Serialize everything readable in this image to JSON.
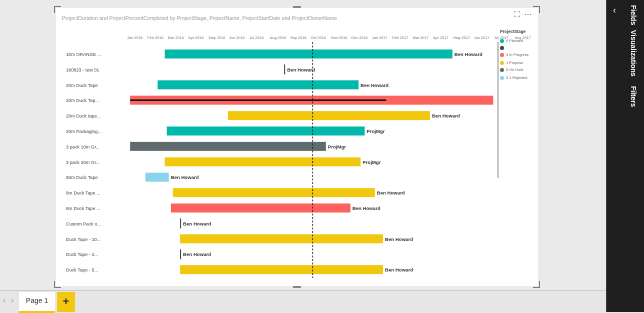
{
  "visual": {
    "title": "ProjectDuration and ProjectPercentCompleted by ProjectStage, ProjectName, ProjectStartDate and ProjectOwnerName",
    "icons": [
      "focus-mode-icon",
      "more-options-icon"
    ]
  },
  "panes": {
    "fields": "Fields",
    "visualizations": "Visualizations",
    "filters": "Filters"
  },
  "pages": {
    "current": "Page 1",
    "add_label": "+"
  },
  "legend": {
    "title": "ProjectStage",
    "items": [
      {
        "label": "0 Planned",
        "color": "#01b8aa"
      },
      {
        "label": "",
        "color": "#374649"
      },
      {
        "label": "4 In Progress",
        "color": "#fd625e"
      },
      {
        "label": "1 Propose",
        "color": "#f2c80f"
      },
      {
        "label": "5 On Hold",
        "color": "#5f6b6d"
      },
      {
        "label": "3.1 Rejected",
        "color": "#8ad4eb"
      }
    ]
  },
  "chart_data": {
    "type": "gantt",
    "months": [
      "Jan 2016",
      "Feb 2016",
      "Mar 2016",
      "Apr 2016",
      "May 2016",
      "Jun 2016",
      "Jul 2016",
      "Aug 2016",
      "Sep 2016",
      "Oct 2016",
      "Nov 2016",
      "Dec 2016",
      "Jan 2017",
      "Feb 2017",
      "Mar 2017",
      "Apr 2017",
      "May 2017",
      "Jun 2017",
      "Jul 2017",
      "Aug 2017"
    ],
    "today_month_index": 9.15,
    "rows": [
      {
        "name": "10m ORANGE ...",
        "start": 1.9,
        "end": 16.0,
        "color": "#01b8aa",
        "owner": "Ben Howard",
        "progress": null
      },
      {
        "name": "160823 - test 01",
        "start": 7.75,
        "end": 7.8,
        "color": "#374649",
        "owner": "Ben Howard",
        "progress": null
      },
      {
        "name": "20m Duck Tape",
        "start": 1.55,
        "end": 11.4,
        "color": "#01b8aa",
        "owner": "Ben Howard",
        "progress": null
      },
      {
        "name": "20m Duck Tap...",
        "start": 0.2,
        "end": 18.0,
        "color": "#fd625e",
        "owner": "",
        "progress": 12.75
      },
      {
        "name": "20m Duck tape...",
        "start": 5.0,
        "end": 14.9,
        "color": "#f2c80f",
        "owner": "Ben Howard",
        "progress": null
      },
      {
        "name": "20m Packaging...",
        "start": 2.0,
        "end": 11.7,
        "color": "#01b8aa",
        "owner": "ProjMgr",
        "progress": null
      },
      {
        "name": "3 pack 10m Gr...",
        "start": 0.2,
        "end": 9.8,
        "color": "#5f6b6d",
        "owner": "ProjMgr",
        "progress": null
      },
      {
        "name": "3 pack 20m Gr...",
        "start": 1.9,
        "end": 11.5,
        "color": "#f2c80f",
        "owner": "ProjMgr",
        "progress": null
      },
      {
        "name": "50m Duck Tape",
        "start": 0.95,
        "end": 2.1,
        "color": "#8ad4eb",
        "owner": "Ben Howard",
        "progress": null
      },
      {
        "name": "6m Duck Tape ...",
        "start": 2.3,
        "end": 12.2,
        "color": "#f2c80f",
        "owner": "Ben Howard",
        "progress": null
      },
      {
        "name": "6m Duck Tape ...",
        "start": 2.2,
        "end": 11.0,
        "color": "#fd625e",
        "owner": "Ben Howard",
        "progress": null
      },
      {
        "name": "Custom Pack o...",
        "start": 2.65,
        "end": 2.7,
        "color": "#374649",
        "owner": "Ben Howard",
        "progress": null
      },
      {
        "name": "Duck Tape - 10...",
        "start": 2.65,
        "end": 12.6,
        "color": "#f2c80f",
        "owner": "Ben Howard",
        "progress": null
      },
      {
        "name": "Duck Tape - 2...",
        "start": 2.65,
        "end": 2.7,
        "color": "#374649",
        "owner": "Ben Howard",
        "progress": null
      },
      {
        "name": "Duck Tape - 5...",
        "start": 2.65,
        "end": 12.6,
        "color": "#f2c80f",
        "owner": "Ben Howard",
        "progress": null
      }
    ]
  }
}
